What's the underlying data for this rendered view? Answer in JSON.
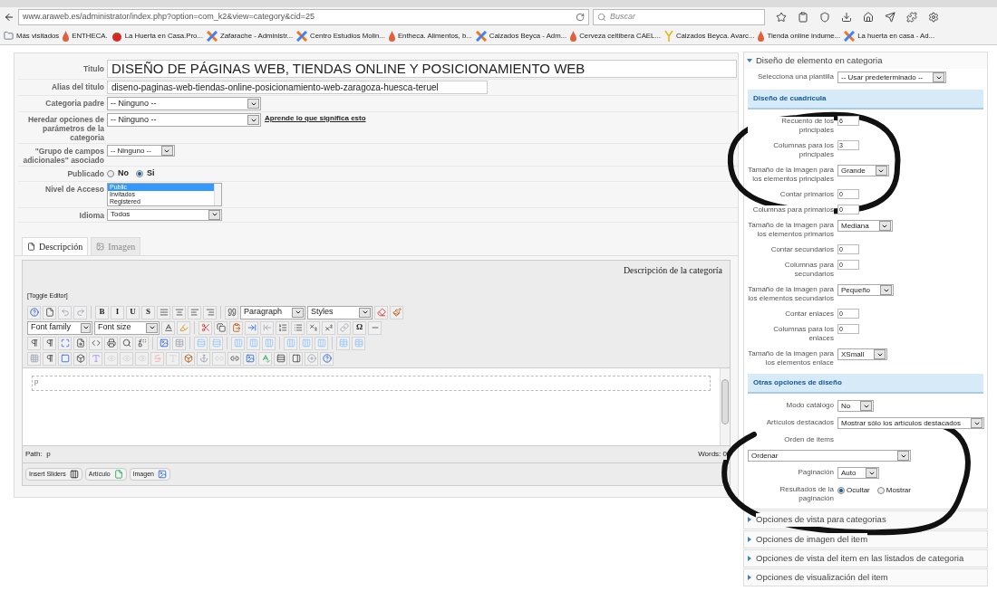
{
  "browser": {
    "url": "www.araweb.es/administrator/index.php?option=com_k2&view=category&cid=25",
    "search_placeholder": "Buscar",
    "bookmarks": [
      {
        "label": "Más visitados",
        "kind": "page"
      },
      {
        "label": "ENTHECA.",
        "kind": "drop"
      },
      {
        "label": "La Huerta en Casa.Pro...",
        "kind": "tomato"
      },
      {
        "label": "Zafarache - Administr...",
        "kind": "joomla"
      },
      {
        "label": "Centro Estudios Molin...",
        "kind": "joomla"
      },
      {
        "label": "Entheca. Alimentos, b...",
        "kind": "drop"
      },
      {
        "label": "Calzados Beyca - Adm...",
        "kind": "joomla"
      },
      {
        "label": "Cerveza celtibera CAEL...",
        "kind": "drop"
      },
      {
        "label": "Calzados Beyca. Avarc...",
        "kind": "fork"
      },
      {
        "label": "Tienda online indume...",
        "kind": "drop"
      },
      {
        "label": "La huerta en casa - Ad...",
        "kind": "joomla"
      }
    ]
  },
  "form": {
    "rows": [
      {
        "kind": "title",
        "label": "Titulo",
        "value": "DISEÑO DE PÁGINAS WEB, TIENDAS ONLINE Y POSICIONAMIENTO WEB"
      },
      {
        "kind": "input",
        "label": "Alias del titulo",
        "value": "diseno-paginas-web-tiendas-online-posicionamiento-web-zaragoza-huesca-teruel"
      },
      {
        "kind": "select",
        "label": "Categoria padre",
        "value": "-- Ninguno --"
      },
      {
        "kind": "select",
        "label": "Heredar opciones de parámetros de la categoria",
        "value": "-- Ninguno --",
        "link": "Aprende lo que significa esto"
      },
      {
        "kind": "small_select",
        "label": "\"Grupo de campos adicionales\" asociado",
        "value": "-- Ninguno --"
      },
      {
        "kind": "radio",
        "label": "Publicado",
        "options": [
          {
            "label": "No",
            "selected": false
          },
          {
            "label": "Si",
            "selected": true
          }
        ]
      },
      {
        "kind": "listbox",
        "label": "Nivel de Acceso",
        "options": [
          {
            "label": "Public",
            "selected": true
          },
          {
            "label": "Invitados",
            "selected": false
          },
          {
            "label": "Registered",
            "selected": false
          }
        ]
      },
      {
        "kind": "medium_select",
        "label": "Idioma",
        "value": "Todos"
      }
    ]
  },
  "tabs": [
    {
      "label": "Descripción",
      "selected": true
    },
    {
      "label": "Imagen",
      "selected": false
    }
  ],
  "editor": {
    "heading": "Descripción de la categoría",
    "toggle": "[Toggle Editor]",
    "toolbar": [
      [
        {
          "kind": "icon"
        },
        {
          "kind": "icon"
        },
        {
          "kind": "icon"
        },
        {
          "kind": "icon"
        },
        {
          "kind": "sep"
        },
        {
          "kind": "letter",
          "label": "B"
        },
        {
          "kind": "letter",
          "label": "I"
        },
        {
          "kind": "letter",
          "label": "U"
        },
        {
          "kind": "letter",
          "label": "S"
        },
        {
          "kind": "icon"
        },
        {
          "kind": "icon"
        },
        {
          "kind": "icon"
        },
        {
          "kind": "icon"
        },
        {
          "kind": "sep"
        },
        {
          "kind": "icon"
        },
        {
          "kind": "select",
          "label": "Paragraph"
        },
        {
          "kind": "select",
          "label": "Styles"
        },
        {
          "kind": "icon"
        },
        {
          "kind": "icon"
        }
      ],
      [
        {
          "kind": "select",
          "label": "Font family"
        },
        {
          "kind": "select",
          "label": "Font size"
        },
        {
          "kind": "icon"
        },
        {
          "kind": "icon"
        },
        {
          "kind": "sep"
        },
        {
          "kind": "icon"
        },
        {
          "kind": "icon"
        },
        {
          "kind": "icon"
        },
        {
          "kind": "icon"
        },
        {
          "kind": "icon"
        },
        {
          "kind": "icon"
        },
        {
          "kind": "icon"
        },
        {
          "kind": "icon"
        },
        {
          "kind": "icon"
        },
        {
          "kind": "icon"
        },
        {
          "kind": "letter",
          "label": "Ω"
        },
        {
          "kind": "icon"
        }
      ],
      [
        {
          "kind": "icon"
        },
        {
          "kind": "icon"
        },
        {
          "kind": "icon"
        },
        {
          "kind": "icon"
        },
        {
          "kind": "icon"
        },
        {
          "kind": "icon"
        },
        {
          "kind": "icon"
        },
        {
          "kind": "icon"
        },
        {
          "kind": "sep"
        },
        {
          "kind": "icon"
        },
        {
          "kind": "icon"
        },
        {
          "kind": "sep"
        },
        {
          "kind": "icon"
        },
        {
          "kind": "icon"
        },
        {
          "kind": "sep"
        },
        {
          "kind": "icon"
        },
        {
          "kind": "icon"
        },
        {
          "kind": "icon"
        },
        {
          "kind": "sep"
        },
        {
          "kind": "icon"
        },
        {
          "kind": "icon"
        },
        {
          "kind": "icon"
        },
        {
          "kind": "sep"
        },
        {
          "kind": "icon"
        },
        {
          "kind": "icon"
        }
      ],
      [
        {
          "kind": "icon"
        },
        {
          "kind": "icon"
        },
        {
          "kind": "icon"
        },
        {
          "kind": "icon"
        },
        {
          "kind": "icon"
        },
        {
          "kind": "icon"
        },
        {
          "kind": "icon"
        },
        {
          "kind": "icon"
        },
        {
          "kind": "icon"
        },
        {
          "kind": "icon"
        },
        {
          "kind": "icon"
        },
        {
          "kind": "icon"
        },
        {
          "kind": "icon"
        },
        {
          "kind": "icon"
        },
        {
          "kind": "icon"
        },
        {
          "kind": "icon"
        },
        {
          "kind": "icon"
        },
        {
          "kind": "icon"
        },
        {
          "kind": "icon"
        },
        {
          "kind": "icon"
        }
      ]
    ],
    "block_tag": "p",
    "path_label": "Path:",
    "path": "p",
    "words": "Words: 0",
    "buttons": [
      {
        "label": "Insert Sliders",
        "kind": "sliders"
      },
      {
        "label": "Artículo",
        "kind": "article"
      },
      {
        "label": "Imagen",
        "kind": "image"
      }
    ]
  },
  "sidebar": {
    "panels": [
      {
        "title": "Diseño de elemento en categoria",
        "expanded": true,
        "rows": [
          {
            "kind": "select",
            "label": "Selecciona una plantilla",
            "value": "-- Usar predeterminado --"
          },
          {
            "kind": "header",
            "label": "Diseño de cuadrícula"
          },
          {
            "kind": "input",
            "label": "Recuento de los principales",
            "value": "6"
          },
          {
            "kind": "input",
            "label": "Columnas para los principales",
            "value": "3"
          },
          {
            "kind": "select",
            "label": "Tamaño de la imagen para los elementos principales",
            "value": "Grande"
          },
          {
            "kind": "input",
            "label": "Contar primarios",
            "value": "0"
          },
          {
            "kind": "input",
            "label": "Columnas para primarios",
            "value": "0"
          },
          {
            "kind": "select",
            "label": "Tamaño de la imagen para los elementos primarios",
            "value": "Mediana"
          },
          {
            "kind": "input",
            "label": "Contar secundarios",
            "value": "0"
          },
          {
            "kind": "input",
            "label": "Columnas para secundarios",
            "value": "0"
          },
          {
            "kind": "select",
            "label": "Tamaño de la imagen para los elementos secundarios",
            "value": "Pequeño"
          },
          {
            "kind": "input",
            "label": "Contar enlaces",
            "value": "0"
          },
          {
            "kind": "input",
            "label": "Columnas para los enlaces",
            "value": "0"
          },
          {
            "kind": "select",
            "label": "Tamaño de la imagen para los elementos enlace",
            "value": "XSmall"
          },
          {
            "kind": "header",
            "label": "Otras opciones de diseño"
          },
          {
            "kind": "select",
            "label": "Modo catálogo",
            "value": "No"
          },
          {
            "kind": "select",
            "label": "Artículos destacados",
            "value": "Mostrar sólo los artículos destacados"
          },
          {
            "kind": "label",
            "label": "Orden de items"
          },
          {
            "kind": "wide_select",
            "value": "Ordenar"
          },
          {
            "kind": "select",
            "label": "Paginación",
            "value": "Auto"
          },
          {
            "kind": "radio",
            "label": "Resultados de la paginación",
            "options": [
              {
                "label": "Ocultar",
                "selected": true
              },
              {
                "label": "Mostrar",
                "selected": false
              }
            ]
          }
        ]
      },
      {
        "title": "Opciones de vista para categorias",
        "expanded": false
      },
      {
        "title": "Opciones de imagen del item",
        "expanded": false
      },
      {
        "title": "Opciones de vista del item en las listados de categoria",
        "expanded": false
      },
      {
        "title": "Opciones de visualización del item",
        "expanded": false
      }
    ]
  }
}
